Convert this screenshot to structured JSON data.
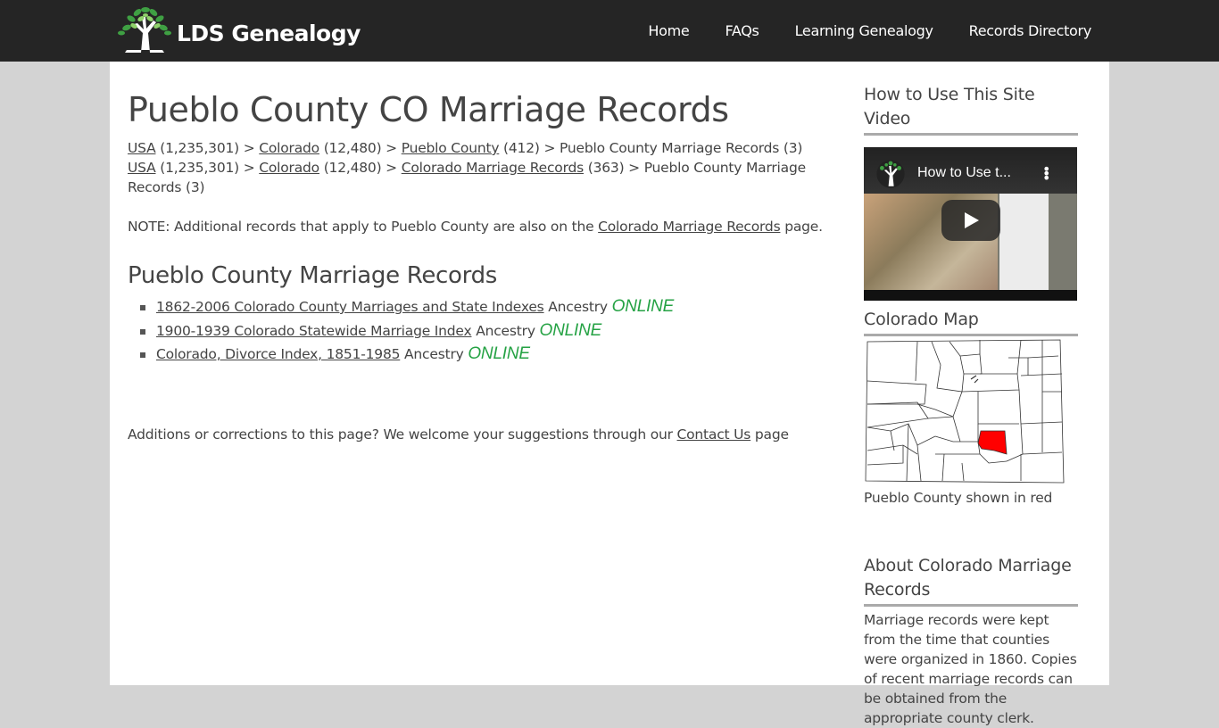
{
  "header": {
    "logo_text": "LDS Genealogy",
    "nav": [
      "Home",
      "FAQs",
      "Learning Genealogy",
      "Records Directory"
    ]
  },
  "main": {
    "title": "Pueblo County CO Marriage Records",
    "breadcrumbs": [
      {
        "items": [
          {
            "label": "USA",
            "link": true,
            "count": "(1,235,301)"
          },
          {
            "label": "Colorado",
            "link": true,
            "count": "(12,480)"
          },
          {
            "label": "Pueblo County",
            "link": true,
            "count": "(412)"
          },
          {
            "label": "Pueblo County Marriage Records",
            "link": false,
            "count": "(3)"
          }
        ]
      },
      {
        "items": [
          {
            "label": "USA",
            "link": true,
            "count": "(1,235,301)"
          },
          {
            "label": "Colorado",
            "link": true,
            "count": "(12,480)"
          },
          {
            "label": "Colorado Marriage Records",
            "link": true,
            "count": "(363)"
          },
          {
            "label": "Pueblo County Marriage Records",
            "link": false,
            "count": "(3)"
          }
        ]
      }
    ],
    "separator": ">",
    "note": {
      "prefix": "NOTE: Additional records that apply to Pueblo County are also on the",
      "link": "Colorado Marriage Records",
      "suffix": "page."
    },
    "section_title": "Pueblo County Marriage Records",
    "records": [
      {
        "link": "1862-2006 Colorado County Marriages and State Indexes",
        "source": "Ancestry",
        "badge": "ONLINE"
      },
      {
        "link": "1900-1939 Colorado Statewide Marriage Index",
        "source": "Ancestry",
        "badge": "ONLINE"
      },
      {
        "link": "Colorado, Divorce Index, 1851-1985",
        "source": "Ancestry",
        "badge": "ONLINE"
      }
    ],
    "footer_note": {
      "prefix": "Additions or corrections to this page? We welcome your suggestions through our",
      "link": "Contact Us",
      "suffix": "page"
    }
  },
  "sidebar": {
    "video_heading": "How to Use This Site Video",
    "video_title": "How to Use t...",
    "map_heading": "Colorado Map",
    "map_caption": "Pueblo County shown in red",
    "about_heading": "About Colorado Marriage Records",
    "about_text": "Marriage records were kept from the time that counties were organized in 1860. Copies of recent marriage records can be obtained from the appropriate county clerk."
  },
  "colors": {
    "topbar": "#252525",
    "online_badge": "#25a244",
    "highlight_county": "#ff0000",
    "background": "#d3d3d3"
  }
}
